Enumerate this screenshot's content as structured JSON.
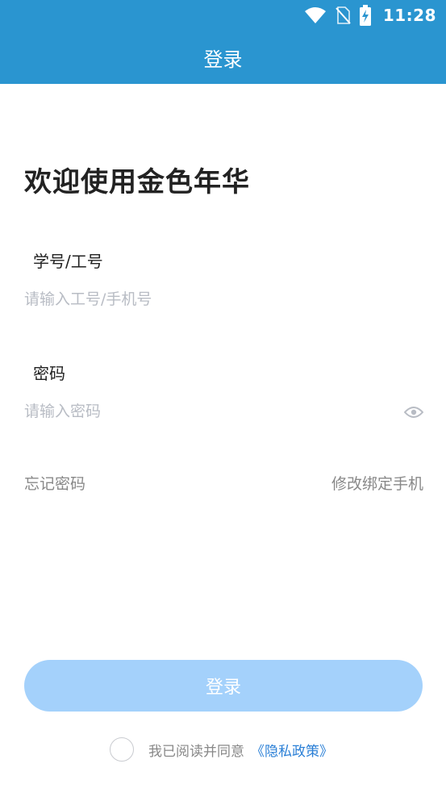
{
  "status_bar": {
    "time": "11:28",
    "icons": [
      "wifi-icon",
      "no-sim-icon",
      "battery-charging-icon"
    ]
  },
  "app_bar": {
    "title": "登录"
  },
  "welcome": "欢迎使用金色年华",
  "account": {
    "label": "学号/工号",
    "placeholder": "请输入工号/手机号",
    "value": ""
  },
  "password": {
    "label": "密码",
    "placeholder": "请输入密码",
    "value": ""
  },
  "links": {
    "forgot": "忘记密码",
    "change_phone": "修改绑定手机"
  },
  "login_button": "登录",
  "agreement": {
    "checked": false,
    "text": "我已阅读并同意",
    "policy": "《隐私政策》"
  },
  "colors": {
    "primary": "#2a95d0",
    "button_disabled": "#a4d1fb",
    "link": "#2a7fd6",
    "placeholder": "#b8bcc4"
  }
}
